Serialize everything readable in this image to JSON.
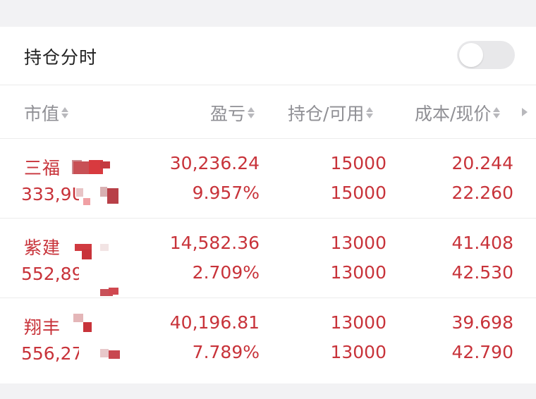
{
  "header": {
    "title": "持仓分时",
    "toggle_on": false
  },
  "columns": [
    {
      "label": "市值"
    },
    {
      "label": "盈亏"
    },
    {
      "label": "持仓/可用"
    },
    {
      "label": "成本/现价"
    }
  ],
  "rows": [
    {
      "name": "三福",
      "market_value": "333,9UC",
      "pl_amount": "30,236.24",
      "pl_percent": "9.957%",
      "position": "15000",
      "available": "15000",
      "cost": "20.244",
      "price": "22.260"
    },
    {
      "name": "紫建",
      "market_value": "552,89(",
      "pl_amount": "14,582.36",
      "pl_percent": "2.709%",
      "position": "13000",
      "available": "13000",
      "cost": "41.408",
      "price": "42.530"
    },
    {
      "name": "翔丰",
      "market_value": "556,27(",
      "pl_amount": "40,196.81",
      "pl_percent": "7.789%",
      "position": "13000",
      "available": "13000",
      "cost": "39.698",
      "price": "42.790"
    }
  ],
  "colors": {
    "value_red": "#c8333a",
    "header_gray": "#8f8f94",
    "divider": "#ececec"
  }
}
